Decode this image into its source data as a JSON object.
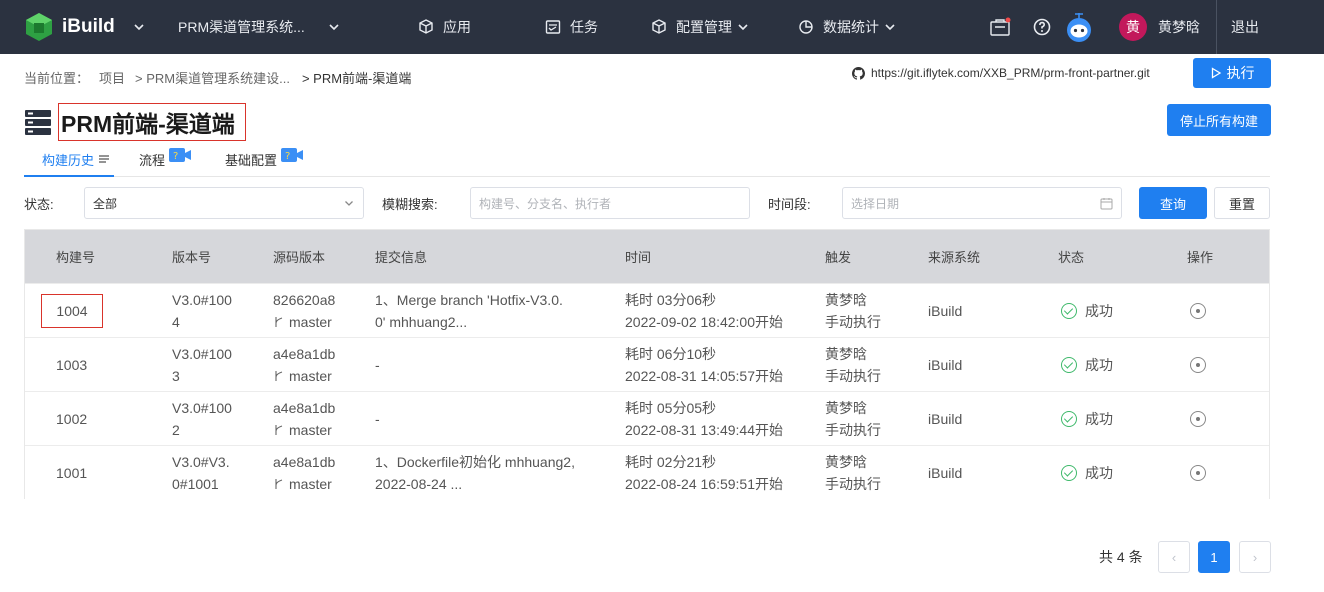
{
  "nav": {
    "logo_text": "iBuild",
    "project_select": "PRM渠道管理系统...",
    "items": [
      {
        "label": "应用",
        "icon": "cube-icon"
      },
      {
        "label": "任务",
        "icon": "task-icon"
      },
      {
        "label": "配置管理",
        "icon": "cube-icon"
      },
      {
        "label": "数据统计",
        "icon": "chart-icon"
      }
    ],
    "user_avatar": "黄",
    "user_name": "黄梦晗",
    "logout": "退出"
  },
  "breadcrumb": {
    "prefix": "当前位置：",
    "items": [
      "项目",
      "> PRM渠道管理系统建设...",
      "> PRM前端-渠道端"
    ]
  },
  "git_url": "https://git.iflytek.com/XXB_PRM/prm-front-partner.git",
  "run_label": "执行",
  "stop_all_label": "停止所有构建",
  "page_title": "PRM前端-渠道端",
  "tabs": [
    {
      "label": "构建历史"
    },
    {
      "label": "流程"
    },
    {
      "label": "基础配置"
    }
  ],
  "filters": {
    "status_label": "状态:",
    "status_value": "全部",
    "fuzzy_label": "模糊搜索:",
    "fuzzy_placeholder": "构建号、分支名、执行者",
    "time_label": "时间段:",
    "time_placeholder": "选择日期",
    "query_label": "查询",
    "reset_label": "重置"
  },
  "table": {
    "headers": [
      "构建号",
      "版本号",
      "源码版本",
      "提交信息",
      "时间",
      "触发",
      "来源系统",
      "状态",
      "操作"
    ],
    "rows": [
      {
        "build": "1004",
        "version1": "V3.0#100",
        "version2": "4",
        "commit": "826620a8",
        "branch": "master",
        "msg1": "1、Merge branch 'Hotfix-V3.0.",
        "msg2": "0' mhhuang2...",
        "duration": "耗时 03分06秒",
        "start": "2022-09-02 18:42:00开始",
        "trigger_user": "黄梦晗",
        "trigger_type": "手动执行",
        "source": "iBuild",
        "status": "成功"
      },
      {
        "build": "1003",
        "version1": "V3.0#100",
        "version2": "3",
        "commit": "a4e8a1db",
        "branch": "master",
        "msg1": "-",
        "msg2": "",
        "duration": "耗时 06分10秒",
        "start": "2022-08-31 14:05:57开始",
        "trigger_user": "黄梦晗",
        "trigger_type": "手动执行",
        "source": "iBuild",
        "status": "成功"
      },
      {
        "build": "1002",
        "version1": "V3.0#100",
        "version2": "2",
        "commit": "a4e8a1db",
        "branch": "master",
        "msg1": "-",
        "msg2": "",
        "duration": "耗时 05分05秒",
        "start": "2022-08-31 13:49:44开始",
        "trigger_user": "黄梦晗",
        "trigger_type": "手动执行",
        "source": "iBuild",
        "status": "成功"
      },
      {
        "build": "1001",
        "version1": "V3.0#V3.",
        "version2": "0#1001",
        "commit": "a4e8a1db",
        "branch": "master",
        "msg1": "1、Dockerfile初始化 mhhuang2,",
        "msg2": "2022-08-24 ...",
        "duration": "耗时 02分21秒",
        "start": "2022-08-24 16:59:51开始",
        "trigger_user": "黄梦晗",
        "trigger_type": "手动执行",
        "source": "iBuild",
        "status": "成功"
      }
    ]
  },
  "pagination": {
    "total": "共 4 条",
    "current_page": "1",
    "prev": "‹",
    "next": "›"
  },
  "colors": {
    "nav_bg": "#2b3240",
    "primary": "#1f7ff0",
    "success": "#3fb96b",
    "highlight_border": "#d9342b"
  }
}
